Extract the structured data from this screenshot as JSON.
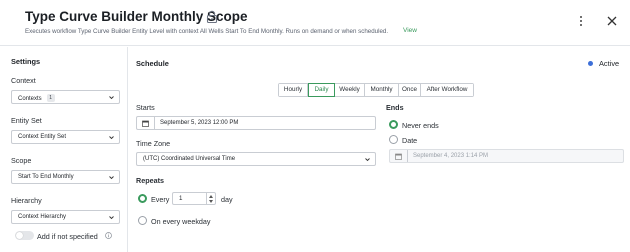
{
  "header": {
    "title": "Type Curve Builder Monthly Scope",
    "subtitle": "Executes workflow Type Curve Builder Entity Level with context All Wells Start To End Monthly. Runs on demand or when scheduled.",
    "view_link": "View"
  },
  "sidebar": {
    "heading": "Settings",
    "context": {
      "label": "Context",
      "value": "Contexts",
      "count": "1"
    },
    "entity_set": {
      "label": "Entity Set",
      "value": "Context Entity Set"
    },
    "scope": {
      "label": "Scope",
      "value": "Start To End Monthly"
    },
    "hierarchy": {
      "label": "Hierarchy",
      "value": "Context Hierarchy"
    },
    "toggle": {
      "label": "Add if not specified",
      "on": false
    }
  },
  "schedule": {
    "heading": "Schedule",
    "status": "Active",
    "status_color": "#3d6fd8",
    "accent_color": "#3a9a5d",
    "frequencies": [
      "Hourly",
      "Daily",
      "Weekly",
      "Monthly",
      "Once",
      "After Workflow"
    ],
    "selected_frequency": "Daily",
    "starts_label": "Starts",
    "starts_value": "September 5, 2023 12:00 PM",
    "timezone_label": "Time Zone",
    "timezone_value": "(UTC) Coordinated Universal Time",
    "ends_label": "Ends",
    "never_ends_label": "Never ends",
    "date_label": "Date",
    "end_date_value": "September 4, 2023 1:14 PM",
    "repeats_label": "Repeats",
    "every_label": "Every",
    "every_value": "1",
    "every_unit": "day",
    "weekday_label": "On every weekday"
  }
}
